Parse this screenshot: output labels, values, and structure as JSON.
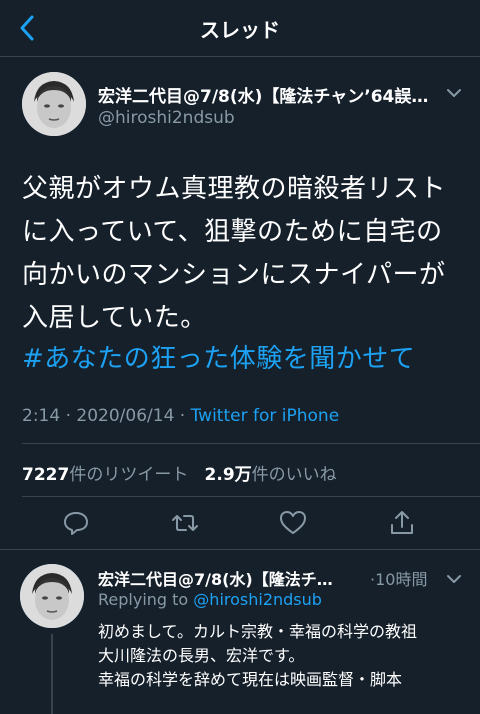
{
  "nav": {
    "title": "スレッド",
    "back_icon": "chevron-left-icon"
  },
  "tweet": {
    "display_name": "宏洋二代目@7/8(水)【隆法チャン’64誤…",
    "handle": "@hiroshi2ndsub",
    "body": "父親がオウム真理教の暗殺者リストに入っていて、狙撃のために自宅の向かいのマンションにスナイパーが入居していた。",
    "hashtag": "#あなたの狂った体験を聞かせて",
    "time": "2:14",
    "date": "2020/06/14",
    "source": "Twitter for iPhone",
    "retweet_count": "7227",
    "retweet_label": "件のリツイート",
    "like_count": "2.9万",
    "like_label": "件のいいね"
  },
  "actions": [
    "reply-icon",
    "retweet-icon",
    "like-icon",
    "share-icon"
  ],
  "reply": {
    "display_name": "宏洋二代目@7/8(水)【隆法チ…",
    "time": "10時間",
    "replying_prefix": "Replying to",
    "replying_to": "@hiroshi2ndsub",
    "body_lines": [
      "初めまして。カルト宗教・幸福の科学の教祖",
      "大川隆法の長男、宏洋です。",
      "幸福の科学を辞めて現在は映画監督・脚本"
    ]
  },
  "colors": {
    "background": "#15202b",
    "accent": "#1da1f2",
    "muted": "#8899a6",
    "divider": "#38444d"
  }
}
